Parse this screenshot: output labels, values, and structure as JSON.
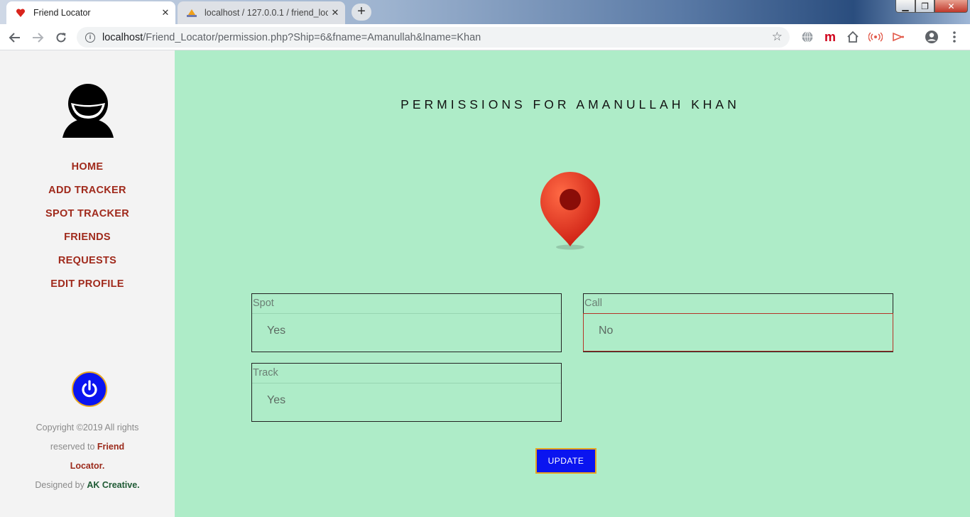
{
  "browser": {
    "tabs": [
      {
        "title": "Friend Locator",
        "close": "✕"
      },
      {
        "title": "localhost / 127.0.0.1 / friend_locat",
        "close": "✕"
      }
    ],
    "new_tab": "+",
    "url_host": "localhost",
    "url_rest": "/Friend_Locator/permission.php?Ship=6&fname=Amanullah&lname=Khan"
  },
  "sidebar": {
    "menu": [
      "HOME",
      "ADD TRACKER",
      "SPOT TRACKER",
      "FRIENDS",
      "REQUESTS",
      "EDIT PROFILE"
    ],
    "footer": {
      "line1": "Copyright ©2019 All rights",
      "line2_prefix": "reserved to ",
      "brand1": "Friend",
      "brand2": "Locator.",
      "designed_prefix": "Designed by ",
      "designer": "AK Creative."
    }
  },
  "main": {
    "heading": "PERMISSIONS FOR AMANULLAH KHAN",
    "fields": [
      {
        "label": "Spot",
        "value": "Yes"
      },
      {
        "label": "Call",
        "value": "No"
      },
      {
        "label": "Track",
        "value": "Yes"
      }
    ],
    "update_label": "UPDATE"
  },
  "colors": {
    "main_bg": "#aeecc8",
    "sidebar_bg": "#f3f3f3",
    "menu_text": "#a02a1c",
    "button_bg": "#0a14f0",
    "button_border": "#e8a51e"
  }
}
